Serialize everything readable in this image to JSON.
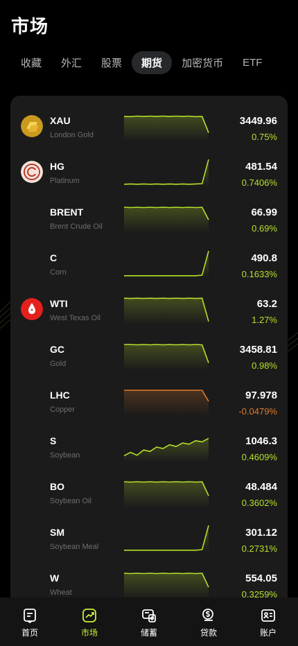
{
  "page": {
    "title": "市场"
  },
  "tabs": [
    {
      "label": "收藏",
      "active": false
    },
    {
      "label": "外汇",
      "active": false
    },
    {
      "label": "股票",
      "active": false
    },
    {
      "label": "期货",
      "active": true
    },
    {
      "label": "加密货币",
      "active": false
    },
    {
      "label": "ETF",
      "active": false
    }
  ],
  "colors": {
    "up": "#b5e02c",
    "down": "#e07b2c",
    "accent": "#c8f03a"
  },
  "rows": [
    {
      "symbol": "XAU",
      "name": "London Gold",
      "price": "3449.96",
      "change": "0.75%",
      "trend": "up",
      "logo": "gold-bar-icon",
      "spark": [
        0.86,
        0.85,
        0.87,
        0.86,
        0.87,
        0.86,
        0.87,
        0.86,
        0.87,
        0.86,
        0.87,
        0.85,
        0.86,
        0.3
      ]
    },
    {
      "symbol": "HG",
      "name": "Platinum",
      "price": "481.54",
      "change": "0.7406%",
      "trend": "up",
      "logo": "platinum-coin-icon",
      "spark": [
        0.1,
        0.11,
        0.1,
        0.11,
        0.1,
        0.11,
        0.1,
        0.11,
        0.1,
        0.11,
        0.1,
        0.11,
        0.12,
        0.95
      ]
    },
    {
      "symbol": "BRENT",
      "name": "Brent Crude Oil",
      "price": "66.99",
      "change": "0.69%",
      "trend": "up",
      "logo": "",
      "spark": [
        0.88,
        0.87,
        0.88,
        0.87,
        0.88,
        0.87,
        0.88,
        0.87,
        0.88,
        0.87,
        0.88,
        0.87,
        0.88,
        0.45
      ]
    },
    {
      "symbol": "C",
      "name": "Corn",
      "price": "490.8",
      "change": "0.1633%",
      "trend": "up",
      "logo": "",
      "spark": [
        0.1,
        0.1,
        0.1,
        0.1,
        0.1,
        0.1,
        0.1,
        0.1,
        0.1,
        0.1,
        0.1,
        0.1,
        0.12,
        0.95
      ]
    },
    {
      "symbol": "WTI",
      "name": "West Texas Oil",
      "price": "63.2",
      "change": "1.27%",
      "trend": "up",
      "logo": "oil-drop-icon",
      "spark": [
        0.9,
        0.89,
        0.9,
        0.89,
        0.9,
        0.89,
        0.9,
        0.89,
        0.9,
        0.89,
        0.9,
        0.89,
        0.9,
        0.1
      ]
    },
    {
      "symbol": "GC",
      "name": "Gold",
      "price": "3458.81",
      "change": "0.98%",
      "trend": "up",
      "logo": "",
      "spark": [
        0.88,
        0.88,
        0.87,
        0.88,
        0.87,
        0.88,
        0.87,
        0.88,
        0.87,
        0.88,
        0.87,
        0.88,
        0.87,
        0.25
      ]
    },
    {
      "symbol": "LHC",
      "name": "Copper",
      "price": "97.978",
      "change": "-0.0479%",
      "trend": "down",
      "logo": "",
      "spark": [
        0.88,
        0.88,
        0.88,
        0.88,
        0.88,
        0.88,
        0.88,
        0.88,
        0.88,
        0.88,
        0.88,
        0.88,
        0.88,
        0.5
      ]
    },
    {
      "symbol": "S",
      "name": "Soybean",
      "price": "1046.3",
      "change": "0.4609%",
      "trend": "up",
      "logo": "",
      "spark": [
        0.2,
        0.32,
        0.22,
        0.4,
        0.35,
        0.5,
        0.45,
        0.58,
        0.52,
        0.64,
        0.6,
        0.72,
        0.68,
        0.8
      ]
    },
    {
      "symbol": "BO",
      "name": "Soybean Oil",
      "price": "48.484",
      "change": "0.3602%",
      "trend": "up",
      "logo": "",
      "spark": [
        0.88,
        0.87,
        0.88,
        0.87,
        0.88,
        0.87,
        0.88,
        0.87,
        0.88,
        0.87,
        0.88,
        0.87,
        0.88,
        0.4
      ]
    },
    {
      "symbol": "SM",
      "name": "Soybean Meal",
      "price": "301.12",
      "change": "0.2731%",
      "trend": "up",
      "logo": "",
      "spark": [
        0.1,
        0.1,
        0.1,
        0.1,
        0.1,
        0.1,
        0.1,
        0.1,
        0.1,
        0.1,
        0.1,
        0.1,
        0.12,
        0.95
      ]
    },
    {
      "symbol": "W",
      "name": "Wheat",
      "price": "554.05",
      "change": "0.3259%",
      "trend": "up",
      "logo": "",
      "spark": [
        0.88,
        0.87,
        0.88,
        0.87,
        0.88,
        0.87,
        0.88,
        0.87,
        0.88,
        0.87,
        0.88,
        0.87,
        0.88,
        0.4
      ]
    }
  ],
  "nav": [
    {
      "label": "首页",
      "icon": "home-news-icon",
      "active": false
    },
    {
      "label": "市场",
      "icon": "market-chart-icon",
      "active": true
    },
    {
      "label": "储蓄",
      "icon": "savings-icon",
      "active": false
    },
    {
      "label": "贷款",
      "icon": "loan-dollar-icon",
      "active": false
    },
    {
      "label": "账户",
      "icon": "account-card-icon",
      "active": false
    }
  ]
}
